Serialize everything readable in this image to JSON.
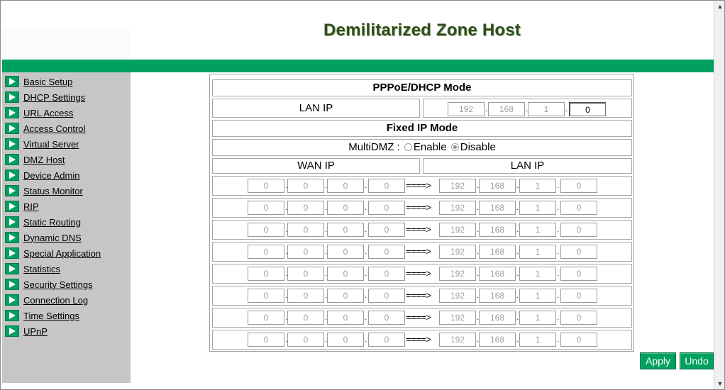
{
  "header": {
    "title": "Demilitarized Zone Host"
  },
  "sidebar": {
    "items": [
      {
        "label": "Basic Setup"
      },
      {
        "label": "DHCP Settings"
      },
      {
        "label": "URL Access"
      },
      {
        "label": "Access Control"
      },
      {
        "label": "Virtual Server"
      },
      {
        "label": "DMZ Host"
      },
      {
        "label": "Device Admin"
      },
      {
        "label": "Status Monitor"
      },
      {
        "label": "RIP"
      },
      {
        "label": "Static Routing"
      },
      {
        "label": "Dynamic DNS"
      },
      {
        "label": "Special Application"
      },
      {
        "label": "Statistics"
      },
      {
        "label": "Security Settings"
      },
      {
        "label": "Connection Log"
      },
      {
        "label": "Time Settings"
      },
      {
        "label": "UPnP"
      }
    ]
  },
  "pppoe": {
    "header": "PPPoE/DHCP Mode",
    "lan_ip_label": "LAN IP",
    "lan_ip": [
      "192",
      "168",
      "1",
      "0"
    ]
  },
  "fixed": {
    "header": "Fixed IP Mode",
    "multidmz_label": "MultiDMZ :",
    "enable_label": "Enable",
    "disable_label": "Disable",
    "selected": "Disable",
    "wan_ip_header": "WAN IP",
    "lan_ip_header": "LAN IP",
    "arrow_text": "====>",
    "rows": [
      {
        "wan": [
          "0",
          "0",
          "0",
          "0"
        ],
        "lan": [
          "192",
          "168",
          "1",
          "0"
        ]
      },
      {
        "wan": [
          "0",
          "0",
          "0",
          "0"
        ],
        "lan": [
          "192",
          "168",
          "1",
          "0"
        ]
      },
      {
        "wan": [
          "0",
          "0",
          "0",
          "0"
        ],
        "lan": [
          "192",
          "168",
          "1",
          "0"
        ]
      },
      {
        "wan": [
          "0",
          "0",
          "0",
          "0"
        ],
        "lan": [
          "192",
          "168",
          "1",
          "0"
        ]
      },
      {
        "wan": [
          "0",
          "0",
          "0",
          "0"
        ],
        "lan": [
          "192",
          "168",
          "1",
          "0"
        ]
      },
      {
        "wan": [
          "0",
          "0",
          "0",
          "0"
        ],
        "lan": [
          "192",
          "168",
          "1",
          "0"
        ]
      },
      {
        "wan": [
          "0",
          "0",
          "0",
          "0"
        ],
        "lan": [
          "192",
          "168",
          "1",
          "0"
        ]
      },
      {
        "wan": [
          "0",
          "0",
          "0",
          "0"
        ],
        "lan": [
          "192",
          "168",
          "1",
          "0"
        ]
      }
    ]
  },
  "buttons": {
    "apply": "Apply",
    "undo": "Undo"
  },
  "colors": {
    "accent_green": "#00a060",
    "sidebar_gray": "#c6c6c6",
    "title_green": "#2e4f1c"
  }
}
